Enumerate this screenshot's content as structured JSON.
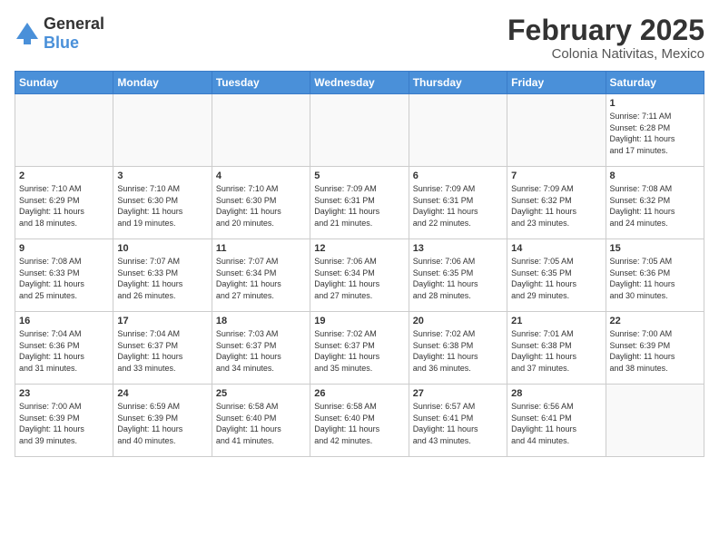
{
  "header": {
    "logo": {
      "general": "General",
      "blue": "Blue"
    },
    "month": "February 2025",
    "location": "Colonia Nativitas, Mexico"
  },
  "weekdays": [
    "Sunday",
    "Monday",
    "Tuesday",
    "Wednesday",
    "Thursday",
    "Friday",
    "Saturday"
  ],
  "weeks": [
    {
      "rowClass": "week-row-1",
      "days": [
        {
          "num": "",
          "info": "",
          "empty": true
        },
        {
          "num": "",
          "info": "",
          "empty": true
        },
        {
          "num": "",
          "info": "",
          "empty": true
        },
        {
          "num": "",
          "info": "",
          "empty": true
        },
        {
          "num": "",
          "info": "",
          "empty": true
        },
        {
          "num": "",
          "info": "",
          "empty": true
        },
        {
          "num": "1",
          "info": "Sunrise: 7:11 AM\nSunset: 6:28 PM\nDaylight: 11 hours\nand 17 minutes."
        }
      ]
    },
    {
      "rowClass": "week-row-2",
      "days": [
        {
          "num": "2",
          "info": "Sunrise: 7:10 AM\nSunset: 6:29 PM\nDaylight: 11 hours\nand 18 minutes."
        },
        {
          "num": "3",
          "info": "Sunrise: 7:10 AM\nSunset: 6:30 PM\nDaylight: 11 hours\nand 19 minutes."
        },
        {
          "num": "4",
          "info": "Sunrise: 7:10 AM\nSunset: 6:30 PM\nDaylight: 11 hours\nand 20 minutes."
        },
        {
          "num": "5",
          "info": "Sunrise: 7:09 AM\nSunset: 6:31 PM\nDaylight: 11 hours\nand 21 minutes."
        },
        {
          "num": "6",
          "info": "Sunrise: 7:09 AM\nSunset: 6:31 PM\nDaylight: 11 hours\nand 22 minutes."
        },
        {
          "num": "7",
          "info": "Sunrise: 7:09 AM\nSunset: 6:32 PM\nDaylight: 11 hours\nand 23 minutes."
        },
        {
          "num": "8",
          "info": "Sunrise: 7:08 AM\nSunset: 6:32 PM\nDaylight: 11 hours\nand 24 minutes."
        }
      ]
    },
    {
      "rowClass": "week-row-3",
      "days": [
        {
          "num": "9",
          "info": "Sunrise: 7:08 AM\nSunset: 6:33 PM\nDaylight: 11 hours\nand 25 minutes."
        },
        {
          "num": "10",
          "info": "Sunrise: 7:07 AM\nSunset: 6:33 PM\nDaylight: 11 hours\nand 26 minutes."
        },
        {
          "num": "11",
          "info": "Sunrise: 7:07 AM\nSunset: 6:34 PM\nDaylight: 11 hours\nand 27 minutes."
        },
        {
          "num": "12",
          "info": "Sunrise: 7:06 AM\nSunset: 6:34 PM\nDaylight: 11 hours\nand 27 minutes."
        },
        {
          "num": "13",
          "info": "Sunrise: 7:06 AM\nSunset: 6:35 PM\nDaylight: 11 hours\nand 28 minutes."
        },
        {
          "num": "14",
          "info": "Sunrise: 7:05 AM\nSunset: 6:35 PM\nDaylight: 11 hours\nand 29 minutes."
        },
        {
          "num": "15",
          "info": "Sunrise: 7:05 AM\nSunset: 6:36 PM\nDaylight: 11 hours\nand 30 minutes."
        }
      ]
    },
    {
      "rowClass": "week-row-4",
      "days": [
        {
          "num": "16",
          "info": "Sunrise: 7:04 AM\nSunset: 6:36 PM\nDaylight: 11 hours\nand 31 minutes."
        },
        {
          "num": "17",
          "info": "Sunrise: 7:04 AM\nSunset: 6:37 PM\nDaylight: 11 hours\nand 33 minutes."
        },
        {
          "num": "18",
          "info": "Sunrise: 7:03 AM\nSunset: 6:37 PM\nDaylight: 11 hours\nand 34 minutes."
        },
        {
          "num": "19",
          "info": "Sunrise: 7:02 AM\nSunset: 6:37 PM\nDaylight: 11 hours\nand 35 minutes."
        },
        {
          "num": "20",
          "info": "Sunrise: 7:02 AM\nSunset: 6:38 PM\nDaylight: 11 hours\nand 36 minutes."
        },
        {
          "num": "21",
          "info": "Sunrise: 7:01 AM\nSunset: 6:38 PM\nDaylight: 11 hours\nand 37 minutes."
        },
        {
          "num": "22",
          "info": "Sunrise: 7:00 AM\nSunset: 6:39 PM\nDaylight: 11 hours\nand 38 minutes."
        }
      ]
    },
    {
      "rowClass": "week-row-5",
      "days": [
        {
          "num": "23",
          "info": "Sunrise: 7:00 AM\nSunset: 6:39 PM\nDaylight: 11 hours\nand 39 minutes."
        },
        {
          "num": "24",
          "info": "Sunrise: 6:59 AM\nSunset: 6:39 PM\nDaylight: 11 hours\nand 40 minutes."
        },
        {
          "num": "25",
          "info": "Sunrise: 6:58 AM\nSunset: 6:40 PM\nDaylight: 11 hours\nand 41 minutes."
        },
        {
          "num": "26",
          "info": "Sunrise: 6:58 AM\nSunset: 6:40 PM\nDaylight: 11 hours\nand 42 minutes."
        },
        {
          "num": "27",
          "info": "Sunrise: 6:57 AM\nSunset: 6:41 PM\nDaylight: 11 hours\nand 43 minutes."
        },
        {
          "num": "28",
          "info": "Sunrise: 6:56 AM\nSunset: 6:41 PM\nDaylight: 11 hours\nand 44 minutes."
        },
        {
          "num": "",
          "info": "",
          "empty": true
        }
      ]
    }
  ]
}
